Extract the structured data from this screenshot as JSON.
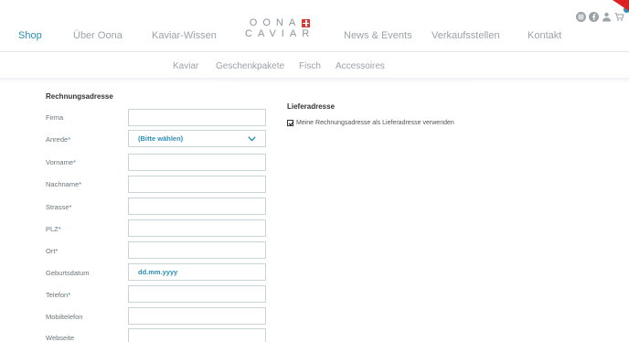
{
  "nav": {
    "main": [
      "Shop",
      "Über Oona",
      "Kaviar-Wissen",
      "News & Events",
      "Verkaufsstellen",
      "Kontakt"
    ],
    "sub": [
      "Kaviar",
      "Geschenkpakete",
      "Fisch",
      "Accessoires"
    ]
  },
  "logo": {
    "line1": "OONA",
    "line2": "CAVIAR"
  },
  "colors": {
    "accent": "#2a8fb5",
    "logo_red": "#d63a36",
    "border": "#c9d4d9"
  },
  "icons": [
    "instagram-icon",
    "facebook-icon",
    "user-icon",
    "cart-icon"
  ],
  "billing": {
    "title": "Rechnungsadresse",
    "firma": {
      "label": "Firma",
      "value": ""
    },
    "anrede": {
      "label": "Anrede",
      "selected": "(Bitte wählen)"
    },
    "vorname": {
      "label": "Vorname",
      "value": ""
    },
    "nachname": {
      "label": "Nachname",
      "value": ""
    },
    "strasse": {
      "label": "Strasse",
      "value": ""
    },
    "plz": {
      "label": "PLZ",
      "value": ""
    },
    "ort": {
      "label": "Ort",
      "value": ""
    },
    "geburtsdatum": {
      "label": "Geburtsdatum",
      "placeholder": "dd.mm.yyyy"
    },
    "telefon": {
      "label": "Telefon",
      "value": ""
    },
    "mobiltelefon": {
      "label": "Mobiltelefon",
      "value": ""
    },
    "webseite": {
      "label": "Webseite",
      "value": ""
    }
  },
  "shipping": {
    "title": "Lieferadresse",
    "same_as_billing_label": "Meine Rechnungsadresse als Lieferadresse verwenden",
    "same_as_billing_checked": true
  },
  "required_mark": "*"
}
